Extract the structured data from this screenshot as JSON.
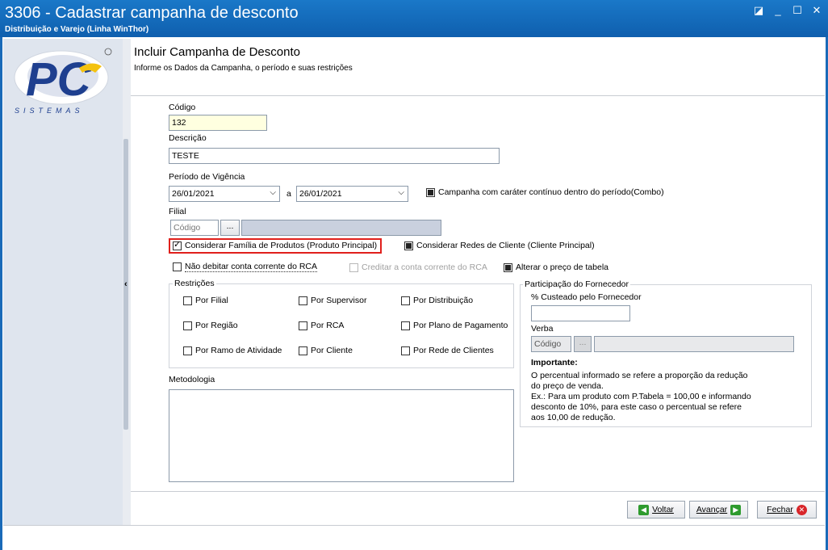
{
  "window": {
    "title": "3306 - Cadastrar campanha de desconto",
    "subtitle": "Distribuição e Varejo (Linha WinThor)",
    "controls": [
      "restore",
      "minimize",
      "maximize",
      "close"
    ]
  },
  "logo": {
    "text": "PC",
    "tagline": "SISTEMAS"
  },
  "header": {
    "title": "Incluir Campanha de Desconto",
    "subtitle": "Informe os Dados da Campanha, o período e suas restrições"
  },
  "form": {
    "codigo": {
      "label": "Código",
      "value": "132"
    },
    "descricao": {
      "label": "Descrição",
      "value": "TESTE"
    },
    "periodo": {
      "label": "Período de Vigência",
      "start": "26/01/2021",
      "separator": "a",
      "end": "26/01/2021"
    },
    "continuo": {
      "label": "Campanha com caráter contínuo dentro do período(Combo)",
      "state": "indeterminate"
    },
    "filial": {
      "label": "Filial",
      "code_placeholder": "Código",
      "lookup": "..."
    },
    "familia": {
      "label": "Considerar Família de Produtos (Produto Principal)",
      "checked": true
    },
    "redes": {
      "label": "Considerar Redes de Cliente (Cliente Principal)",
      "state": "indeterminate"
    },
    "nao_debitar": {
      "label": "Não debitar conta corrente do RCA",
      "checked": false
    },
    "creditar": {
      "label": "Creditar a conta corrente do RCA",
      "enabled": false
    },
    "alterar_preco": {
      "label": "Alterar o preço de tabela",
      "state": "indeterminate"
    }
  },
  "restricoes": {
    "title": "Restrições",
    "items": [
      "Por Filial",
      "Por Supervisor",
      "Por Distribuição",
      "Por Região",
      "Por RCA",
      "Por Plano de Pagamento",
      "Por Ramo de Atividade",
      "Por Cliente",
      "Por Rede de Clientes"
    ]
  },
  "metodologia": {
    "label": "Metodologia",
    "value": ""
  },
  "fornecedor": {
    "title": "Participação do Fornecedor",
    "custeado_label": "% Custeado pelo Fornecedor",
    "verba_label": "Verba",
    "verba_placeholder": "Código",
    "lookup": "...",
    "important_title": "Importante:",
    "important_text1": "O percentual informado se refere a proporção da redução",
    "important_text2": "do preço de venda.",
    "important_text3": "Ex.: Para um produto com P.Tabela = 100,00 e informando",
    "important_text4": "desconto de 10%, para este caso o percentual se refere",
    "important_text5": "aos 10,00 de redução."
  },
  "buttons": {
    "voltar": "Voltar",
    "avancar": "Avançar",
    "fechar": "Fechar"
  },
  "colors": {
    "titlebar": "#1a6ab8",
    "highlight_border": "#e0201c",
    "code_field_bg": "#ffffe0",
    "lookup_field_bg": "#c9d0de"
  }
}
